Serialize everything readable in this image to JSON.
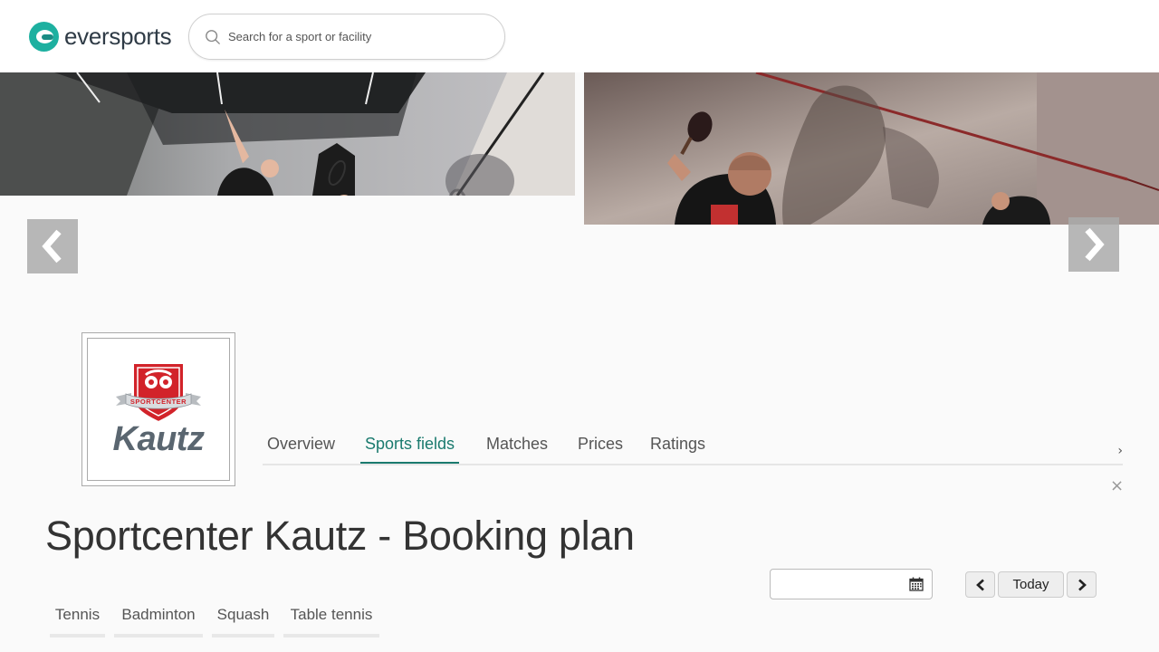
{
  "header": {
    "brand": "eversports",
    "search_placeholder": "Search for a sport or facility"
  },
  "venue": {
    "logo_badge_text": "SPORTCENTER",
    "logo_wordmark": "Kautz"
  },
  "tabs": [
    {
      "label": "Overview",
      "active": false
    },
    {
      "label": "Sports fields",
      "active": true
    },
    {
      "label": "Matches",
      "active": false
    },
    {
      "label": "Prices",
      "active": false
    },
    {
      "label": "Ratings",
      "active": false
    }
  ],
  "tabs_more": "›",
  "close_label": "×",
  "page_title": "Sportcenter Kautz - Booking plan",
  "date_picker": {
    "value": ""
  },
  "day_nav": {
    "today_label": "Today"
  },
  "sport_tabs": [
    "Tennis",
    "Badminton",
    "Squash",
    "Table tennis"
  ],
  "colors": {
    "accent": "#1a7a6e",
    "brand": "#1db0a0",
    "badge_red": "#d2232a"
  }
}
